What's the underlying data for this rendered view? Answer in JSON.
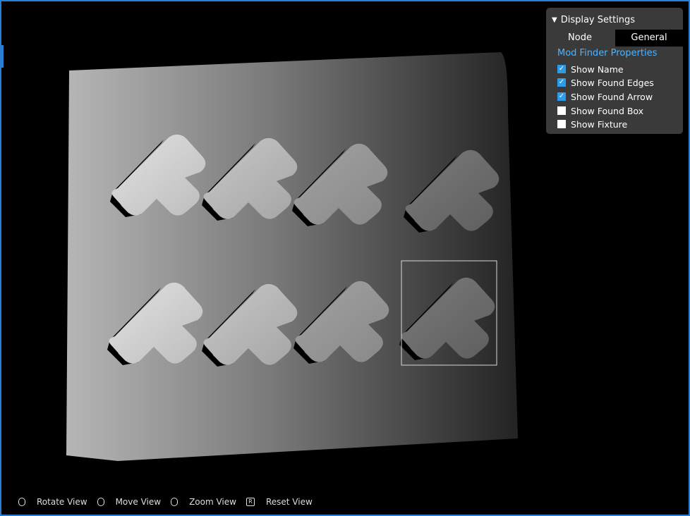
{
  "display_settings": {
    "title": "Display Settings",
    "tabs": [
      "Node",
      "General"
    ],
    "active_tab": "General",
    "section_title": "Mod Finder Properties",
    "options": [
      {
        "label": "Show Name",
        "checked": true
      },
      {
        "label": "Show Found Edges",
        "checked": true
      },
      {
        "label": "Show Found Arrow",
        "checked": true
      },
      {
        "label": "Show Found Box",
        "checked": false
      },
      {
        "label": "Show Fixture",
        "checked": false
      }
    ]
  },
  "footer": {
    "rotate": "Rotate View",
    "move": "Move View",
    "zoom": "Zoom View",
    "reset": "Reset View",
    "reset_key": "R"
  },
  "colors": {
    "accent": "#2a7fd4",
    "section_title": "#4fb3ff",
    "panel_bg": "#3a3a3a"
  }
}
